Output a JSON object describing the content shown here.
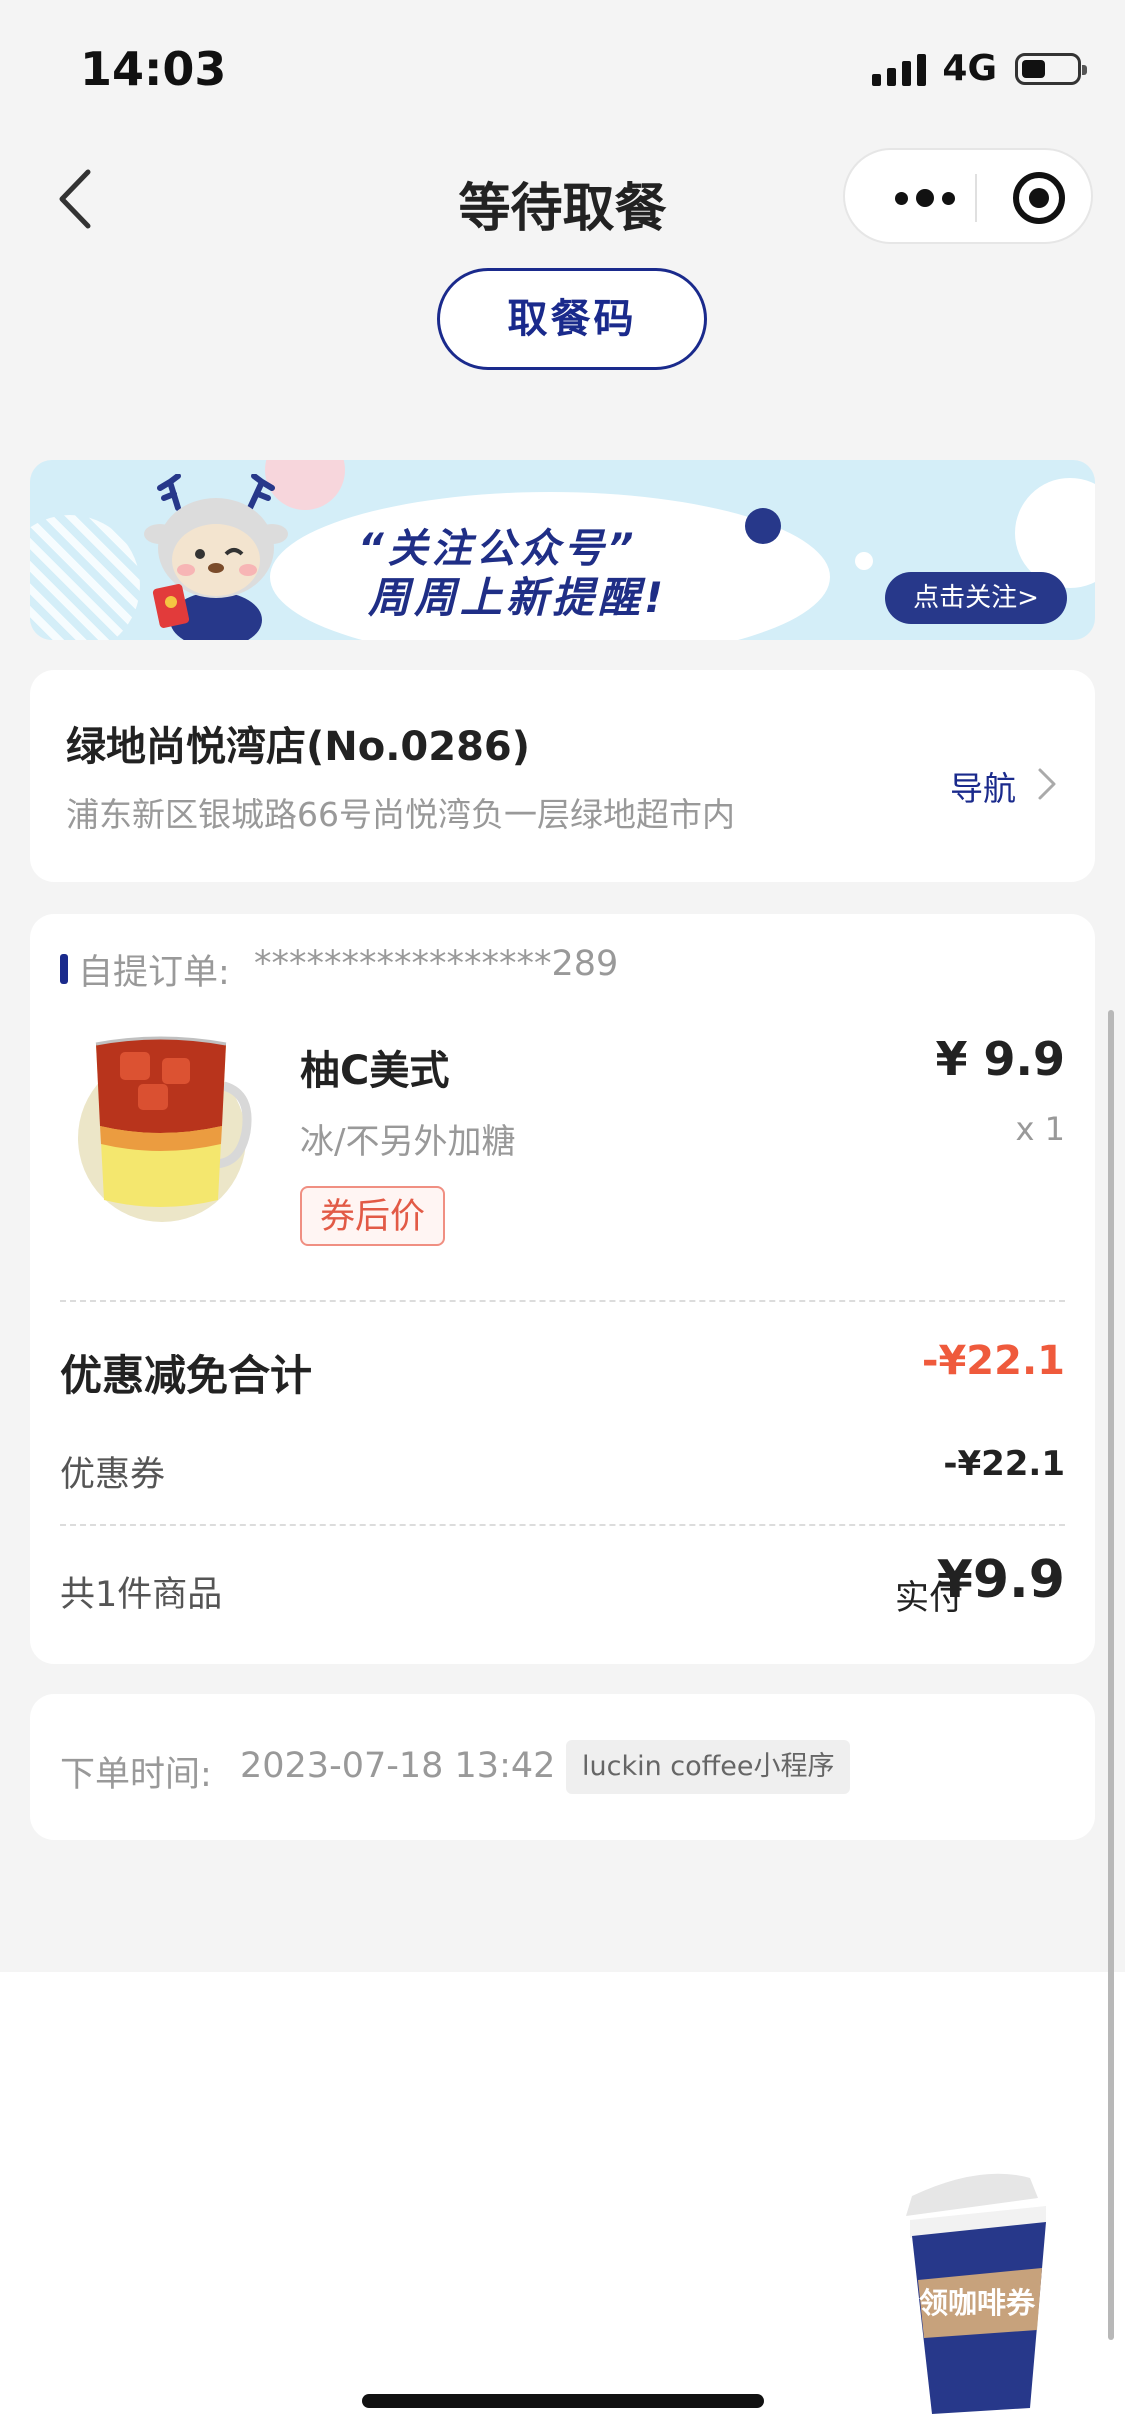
{
  "status_bar": {
    "time": "14:03",
    "network": "4G",
    "battery_level": 0.45
  },
  "nav": {
    "title": "等待取餐"
  },
  "pickup_code_label": "取餐码",
  "banner": {
    "line1": "“关注公众号”",
    "line2": "周周上新提醒!",
    "follow_label": "点击关注>"
  },
  "store": {
    "name": "绿地尚悦湾店(No.0286)",
    "address": "浦东新区银城路66号尚悦湾负一层绿地超市内",
    "nav_label": "导航"
  },
  "order": {
    "type_label": "自提订单:",
    "number": "*****************289",
    "item": {
      "name": "柚C美式",
      "spec": "冰/不另外加糖",
      "coupon_tag": "券后价",
      "price": "¥ 9.9",
      "quantity": "x 1"
    },
    "discount_title": "优惠减免合计",
    "discount_total": "-¥22.1",
    "voucher_label": "优惠券",
    "voucher_value": "-¥22.1",
    "count_label": "共1件商品",
    "paid_label": "实付",
    "paid_value": "¥9.9"
  },
  "order_time": {
    "label": "下单时间:",
    "value": "2023-07-18 13:42",
    "source": "luckin coffee小程序"
  },
  "float_coupon": {
    "label": "领咖啡券"
  },
  "colors": {
    "brand_blue": "#1a2a8c",
    "discount_red": "#ef5a3c",
    "page_bg": "#f4f4f4"
  }
}
